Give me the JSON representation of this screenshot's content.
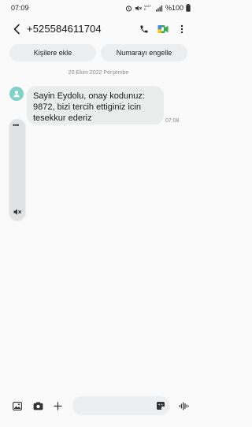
{
  "status_bar": {
    "time": "07:09",
    "battery_text": "%100",
    "network_label": "VoLTE"
  },
  "header": {
    "contact": "+525584611704",
    "icons": [
      "back-arrow-icon",
      "phone-icon",
      "video-call-icon",
      "more-icon"
    ]
  },
  "actions": {
    "add_contact": "Kişilere ekle",
    "block_number": "Numarayı engelle"
  },
  "conversation": {
    "date": "20 Ekim 2022 Perşembe",
    "messages": [
      {
        "text": "Sayin Eydolu, onay kodunuz: 9872, bizi tercih ettiginiz icin tesekkur ederiz",
        "time": "07:08"
      }
    ]
  },
  "side_panel": {
    "menu_label": "•••"
  },
  "composer": {
    "value": "",
    "icons": [
      "gallery-icon",
      "camera-icon",
      "plus-icon",
      "sticker-icon",
      "voice-icon"
    ]
  },
  "colors": {
    "background": "#fafafa",
    "bubble": "#ebeded",
    "pill": "#eceef0",
    "avatar": "#7fd2c7"
  }
}
